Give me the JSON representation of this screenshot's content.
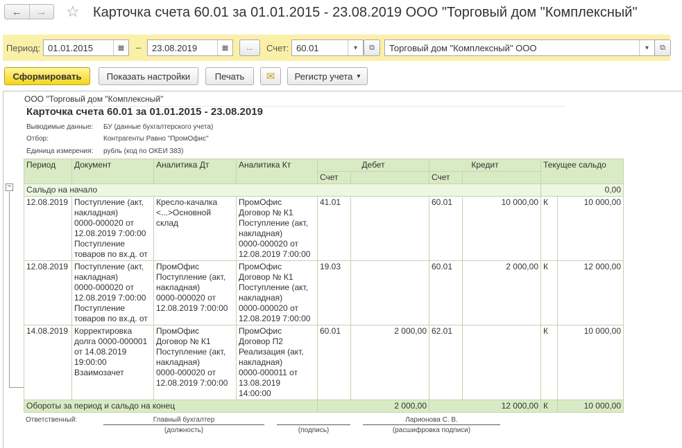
{
  "window": {
    "title": "Карточка счета 60.01 за 01.01.2015 - 23.08.2019 ООО \"Торговый дом \"Комплексный\"",
    "back_icon": "←",
    "forward_icon": "→",
    "star_icon": "☆"
  },
  "filters": {
    "period_label": "Период:",
    "period_from": "01.01.2015",
    "period_dash": "–",
    "period_to": "23.08.2019",
    "period_btn": "...",
    "account_label": "Счет:",
    "account_value": "60.01",
    "org_value": "Торговый дом \"Комплексный\" ООО",
    "calendar_icon": "▦",
    "dropdown_icon": "▾",
    "open_icon": "⧉"
  },
  "toolbar": {
    "generate": "Сформировать",
    "settings": "Показать настройки",
    "print": "Печать",
    "mail_icon": "✉",
    "register": "Регистр учета",
    "register_arrow": "▾"
  },
  "report": {
    "organization": "ООО \"Торговый дом \"Комплексный\"",
    "title": "Карточка счета 60.01 за 01.01.2015 - 23.08.2019",
    "meta": [
      {
        "label": "Выводимые данные:",
        "value": "БУ (данные бухгалтерского учета)"
      },
      {
        "label": "Отбор:",
        "value": "Контрагенты Равно \"ПромОфис\""
      },
      {
        "label": "Единица измерения:",
        "value": "рубль (код по ОКЕИ 383)"
      }
    ],
    "columns": {
      "period": "Период",
      "document": "Документ",
      "analytics_dt": "Аналитика Дт",
      "analytics_kt": "Аналитика Кт",
      "debit": "Дебет",
      "credit": "Кредит",
      "balance": "Текущее сальдо",
      "account": "Счет"
    },
    "opening_balance": {
      "label": "Сальдо на начало",
      "value": "0,00"
    },
    "rows": [
      {
        "period": "12.08.2019",
        "document": "Поступление (акт,\nнакладная)\n0000-000020 от\n12.08.2019 7:00:00\nПоступление\nтоваров по вх.д.  от",
        "analytics_dt": "Кресло-качалка\n<...>Основной\nсклад",
        "analytics_kt": "ПромОфис\nДоговор № К1\nПоступление (акт,\nнакладная)\n0000-000020 от\n12.08.2019 7:00:00",
        "debit_account": "41.01",
        "debit_amount": "",
        "credit_account": "60.01",
        "credit_amount": "10 000,00",
        "balance_type": "К",
        "balance_amount": "10 000,00"
      },
      {
        "period": "12.08.2019",
        "document": "Поступление (акт,\nнакладная)\n0000-000020 от\n12.08.2019 7:00:00\nПоступление\nтоваров по вх.д.  от",
        "analytics_dt": "ПромОфис\nПоступление (акт,\nнакладная)\n0000-000020 от\n12.08.2019 7:00:00",
        "analytics_kt": "ПромОфис\nДоговор № К1\nПоступление (акт,\nнакладная)\n0000-000020 от\n12.08.2019 7:00:00",
        "debit_account": "19.03",
        "debit_amount": "",
        "credit_account": "60.01",
        "credit_amount": "2 000,00",
        "balance_type": "К",
        "balance_amount": "12 000,00"
      },
      {
        "period": "14.08.2019",
        "document": "Корректировка\nдолга 0000-000001\nот 14.08.2019\n19:00:00\nВзаимозачет",
        "analytics_dt": "ПромОфис\nДоговор № К1\nПоступление (акт,\nнакладная)\n0000-000020 от\n12.08.2019 7:00:00",
        "analytics_kt": "ПромОфис\nДоговор П2\nРеализация (акт,\nнакладная)\n0000-000011 от\n13.08.2019 14:00:00",
        "debit_account": "60.01",
        "debit_amount": "2 000,00",
        "credit_account": "62.01",
        "credit_amount": "",
        "balance_type": "К",
        "balance_amount": "10 000,00"
      }
    ],
    "totals": {
      "label": "Обороты за период и сальдо на конец",
      "debit": "2 000,00",
      "credit": "12 000,00",
      "balance_type": "К",
      "balance": "10 000,00"
    },
    "signature": {
      "responsible_label": "Ответственный:",
      "position_value": "Главный бухгалтер",
      "position_caption": "(должность)",
      "sign_caption": "(подпись)",
      "name_value": "Ларионова С. В.",
      "name_caption": "(расшифровка подписи)"
    }
  }
}
